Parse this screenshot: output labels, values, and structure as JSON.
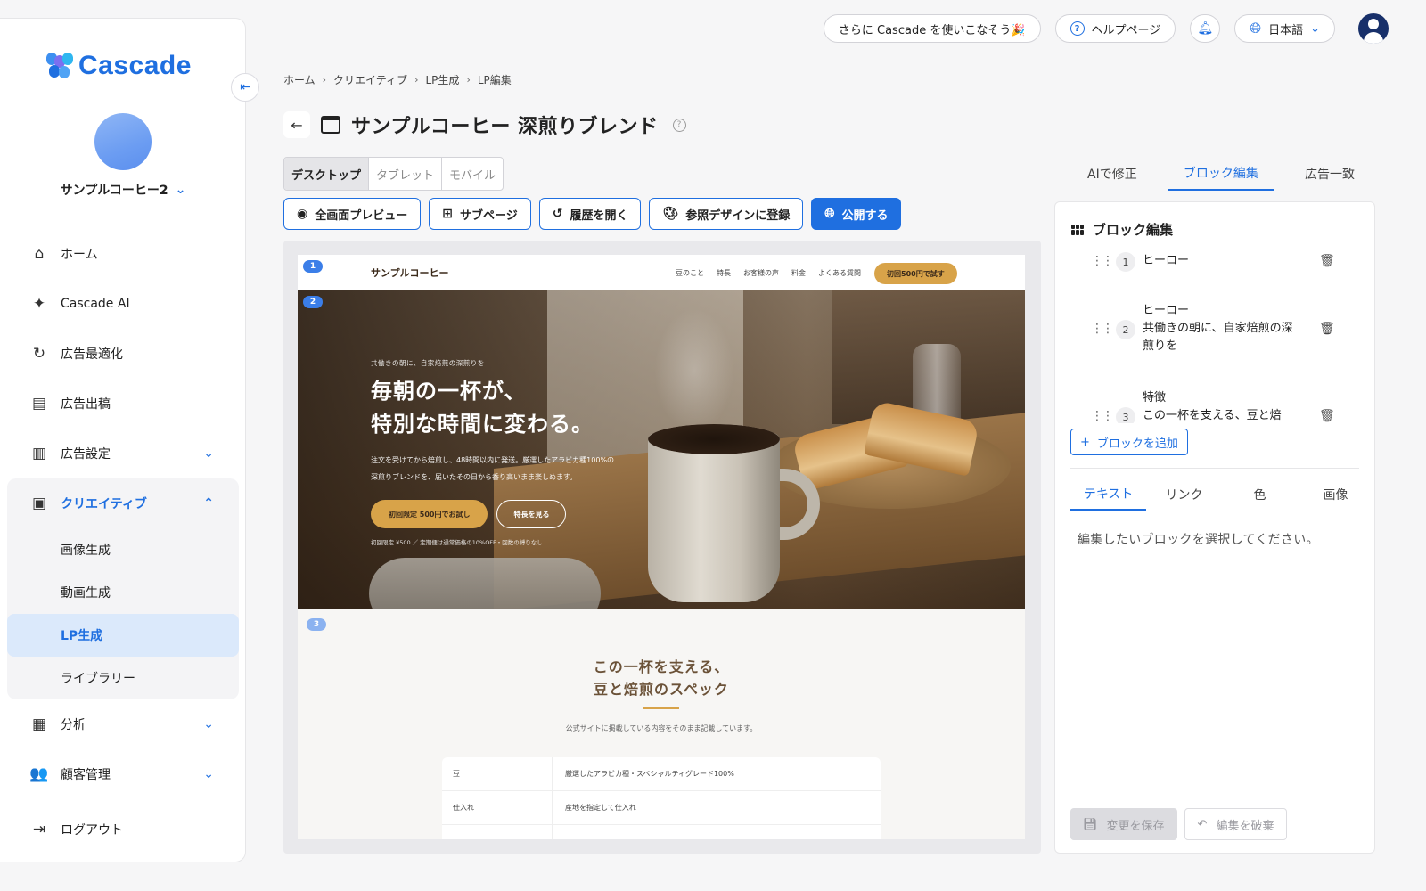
{
  "brand": {
    "name": "Cascade"
  },
  "account": {
    "name": "サンプルコーヒー2"
  },
  "nav": {
    "home": "ホーム",
    "ai": "Cascade AI",
    "ad_opt": "広告最適化",
    "ad_post": "広告出稿",
    "ad_settings": "広告設定",
    "creative": "クリエイティブ",
    "creative_sub": {
      "image": "画像生成",
      "video": "動画生成",
      "lp": "LP生成",
      "library": "ライブラリー"
    },
    "analytics": "分析",
    "customers": "顧客管理",
    "logout": "ログアウト"
  },
  "topbar": {
    "promo": "さらに Cascade を使いこなそう🎉",
    "help": "ヘルプページ",
    "language": "日本語"
  },
  "breadcrumb": [
    "ホーム",
    "クリエイティブ",
    "LP生成",
    "LP編集"
  ],
  "page": {
    "title": "サンプルコーヒー 深煎りブレンド"
  },
  "devices": [
    "デスクトップ",
    "タブレット",
    "モバイル"
  ],
  "actions": {
    "preview": "全画面プレビュー",
    "subpage": "サブページ",
    "history": "履歴を開く",
    "register": "参照デザインに登録",
    "publish": "公開する"
  },
  "lp": {
    "badges": [
      "1",
      "2",
      "3"
    ],
    "logo": "サンプルコーヒー",
    "links": [
      "豆のこと",
      "特長",
      "お客様の声",
      "料金",
      "よくある質問"
    ],
    "cta": "初回500円で試す",
    "hero": {
      "eyebrow": "共働きの朝に、自家焙煎の深煎りを",
      "h1_line1": "毎朝の一杯が、",
      "h1_line2": "特別な時間に変わる。",
      "body_line1": "注文を受けてから焙煎し、48時間以内に発送。厳選したアラビカ種100%の",
      "body_line2": "深煎りブレンドを、届いたその日から香り高いまま楽しめます。",
      "btn_primary": "初回限定 500円でお試し",
      "btn_secondary": "特長を見る",
      "note": "初回限定 ¥500 ／ 定期便は通常価格の10%OFF・回数の縛りなし"
    },
    "spec": {
      "title_line1": "この一杯を支える、",
      "title_line2": "豆と焙煎のスペック",
      "sub": "公式サイトに掲載している内容をそのまま記載しています。",
      "rows": [
        {
          "k": "豆",
          "v": "厳選したアラビカ種・スペシャルティグレード100%"
        },
        {
          "k": "仕入れ",
          "v": "産地を指定して仕入れ"
        }
      ]
    }
  },
  "right": {
    "tabs": [
      "AIで修正",
      "ブロック編集",
      "広告一致"
    ],
    "panel_title": "ブロック編集",
    "blocks": [
      {
        "num": "1",
        "line1": "ヒーロー",
        "line2": ""
      },
      {
        "num": "2",
        "line1": "ヒーロー",
        "line2": "共働きの朝に、自家焙煎の深煎りを"
      },
      {
        "num": "3",
        "line1": "特徴",
        "line2": "この一杯を支える、豆と焙"
      }
    ],
    "add_block": "ブロックを追加",
    "subtabs": [
      "テキスト",
      "リンク",
      "色",
      "画像"
    ],
    "empty": "編集したいブロックを選択してください。",
    "save": "変更を保存",
    "discard": "編集を破棄"
  },
  "colors": {
    "accent": "#1f6fe0",
    "active_bg": "#dbe9fb",
    "lp_gold": "#d8a349",
    "lp_brown": "#6b5238"
  }
}
